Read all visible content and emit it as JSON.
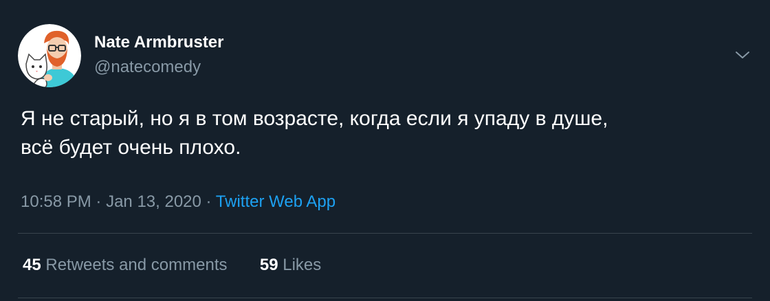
{
  "user": {
    "display_name": "Nate Armbruster",
    "handle": "@natecomedy"
  },
  "tweet": {
    "text_line1": "Я не старый, но я в том возрасте, когда если я упаду в душе,",
    "text_line2": "всё будет очень плохо.",
    "time": "10:58 PM",
    "separator": "·",
    "date": "Jan 13, 2020",
    "source": "Twitter Web App"
  },
  "stats": {
    "retweets_count": "45",
    "retweets_label": "Retweets and comments",
    "likes_count": "59",
    "likes_label": "Likes"
  },
  "icons": {
    "avatar": "avatar-illustration",
    "more": "chevron-down-icon"
  },
  "colors": {
    "background": "#15202b",
    "primary_text": "#ffffff",
    "secondary_text": "#8899a6",
    "link": "#1da1f2",
    "divider": "#38444d"
  }
}
